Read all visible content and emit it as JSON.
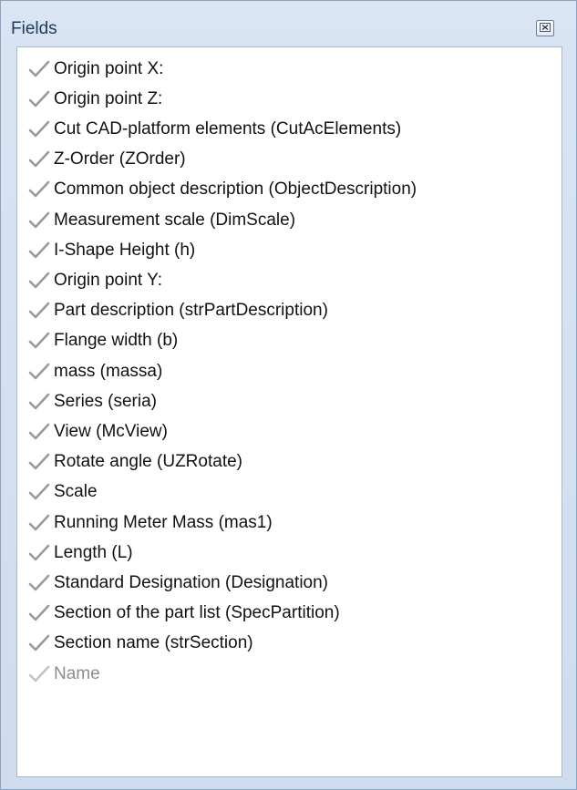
{
  "panel": {
    "title": "Fields",
    "close_icon": "close-icon"
  },
  "fields": [
    {
      "label": "Origin point X:",
      "enabled": true
    },
    {
      "label": "Origin point Z:",
      "enabled": true
    },
    {
      "label": "Cut CAD-platform elements (CutAcElements)",
      "enabled": true
    },
    {
      "label": "Z-Order (ZOrder)",
      "enabled": true
    },
    {
      "label": "Common object description (ObjectDescription)",
      "enabled": true
    },
    {
      "label": "Measurement scale (DimScale)",
      "enabled": true
    },
    {
      "label": "I-Shape Height (h)",
      "enabled": true
    },
    {
      "label": "Origin point Y:",
      "enabled": true
    },
    {
      "label": "Part description (strPartDescription)",
      "enabled": true
    },
    {
      "label": "Flange width (b)",
      "enabled": true
    },
    {
      "label": "mass (massa)",
      "enabled": true
    },
    {
      "label": "Series (seria)",
      "enabled": true
    },
    {
      "label": "View (McView)",
      "enabled": true
    },
    {
      "label": "Rotate angle (UZRotate)",
      "enabled": true
    },
    {
      "label": "Scale",
      "enabled": true
    },
    {
      "label": "Running Meter Mass (mas1)",
      "enabled": true
    },
    {
      "label": "Length (L)",
      "enabled": true
    },
    {
      "label": "Standard Designation (Designation)",
      "enabled": true
    },
    {
      "label": "Section of the part list (SpecPartition)",
      "enabled": true
    },
    {
      "label": "Section name (strSection)",
      "enabled": true
    },
    {
      "label": "Name",
      "enabled": false
    }
  ],
  "icon": "checkmark-icon",
  "colors": {
    "panel_background": "#d5e1f0",
    "title_text": "#1e395b",
    "list_background": "#ffffff",
    "checkmark": "#9a9a9a",
    "disabled_text": "#8d8d8d"
  }
}
